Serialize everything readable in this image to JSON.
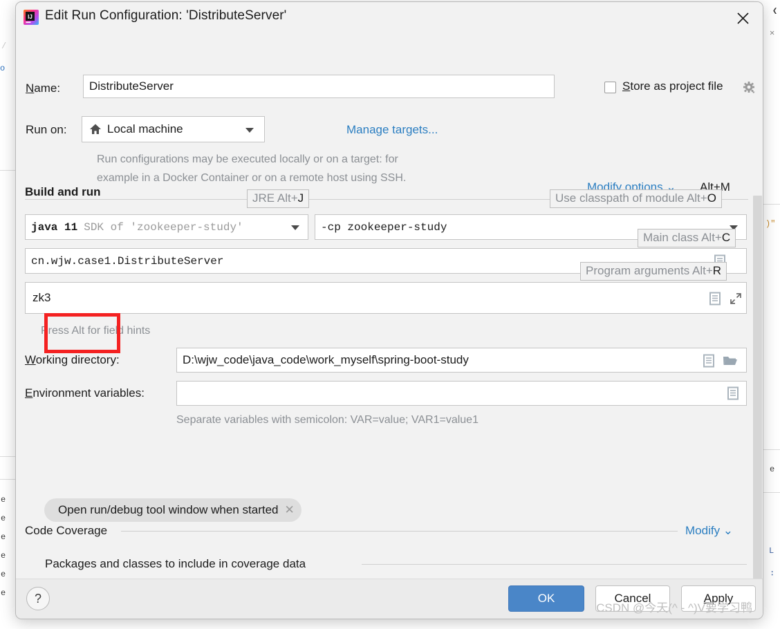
{
  "window": {
    "title": "Edit Run Configuration: 'DistributeServer'",
    "app_icon": "intellij-idea-icon",
    "close_icon": "close-icon"
  },
  "form": {
    "name_label": "Name:",
    "name_value": "DistributeServer",
    "store_as_project_file_label": "Store as project file",
    "store_as_project_file_checked": false,
    "store_gear_icon": "gear-icon",
    "run_on_label": "Run on:",
    "run_on_value": "Local machine",
    "run_on_icon": "home-icon",
    "manage_targets_link": "Manage targets...",
    "run_on_description_line1": "Run configurations may be executed locally or on a target: for",
    "run_on_description_line2": "example in a Docker Container or on a remote host using SSH."
  },
  "build_and_run": {
    "section_title": "Build and run",
    "modify_options_link": "Modify options",
    "modify_options_shortcut": "Alt+M",
    "jre_value_bold": "java 11",
    "jre_value_muted": "SDK of 'zookeeper-study'",
    "classpath_value": "-cp zookeeper-study",
    "main_class_value": "cn.wjw.case1.DistributeServer",
    "program_arguments_value": "zk3",
    "field_hints_note": "Press Alt for field hints",
    "tooltips": [
      {
        "prefix": "JRE Alt+",
        "key": "J"
      },
      {
        "prefix": "Use classpath of module Alt+",
        "key": "O"
      },
      {
        "prefix": "Main class Alt+",
        "key": "C"
      },
      {
        "prefix": "Program arguments Alt+",
        "key": "R"
      }
    ],
    "expand_icon": "expand-icon",
    "macro_icon": "document-icon"
  },
  "directories": {
    "working_directory_label": "Working directory:",
    "working_directory_value": "D:\\wjw_code\\java_code\\work_myself\\spring-boot-study",
    "working_directory_macro_icon": "document-icon",
    "working_directory_browse_icon": "folder-icon",
    "environment_variables_label": "Environment variables:",
    "environment_variables_value": "",
    "environment_variables_icon": "document-icon",
    "environment_variables_hint": "Separate variables with semicolon: VAR=value; VAR1=value1"
  },
  "options": {
    "chip_label": "Open run/debug tool window when started",
    "chip_remove_icon": "close-icon"
  },
  "code_coverage": {
    "section_title": "Code Coverage",
    "modify_link": "Modify",
    "modify_chevron_icon": "chevron-down-icon",
    "subsection_title": "Packages and classes to include in coverage data"
  },
  "footer": {
    "help_label": "?",
    "ok_label": "OK",
    "cancel_label": "Cancel",
    "apply_label": "Apply"
  },
  "watermark": "CSDN @今天(^ - ^)V要学习鸭",
  "colors": {
    "accent_blue": "#2b7ec1",
    "primary_button": "#4a86c8",
    "annotation_red": "#f42121",
    "dialog_bg": "#f2f2f2"
  },
  "background_editor": {
    "gutter_glyphs": [
      "e",
      "e",
      "e",
      "e",
      "e",
      "e"
    ],
    "right_glyphs": [
      "×",
      "›",
      "L",
      "∷"
    ]
  }
}
